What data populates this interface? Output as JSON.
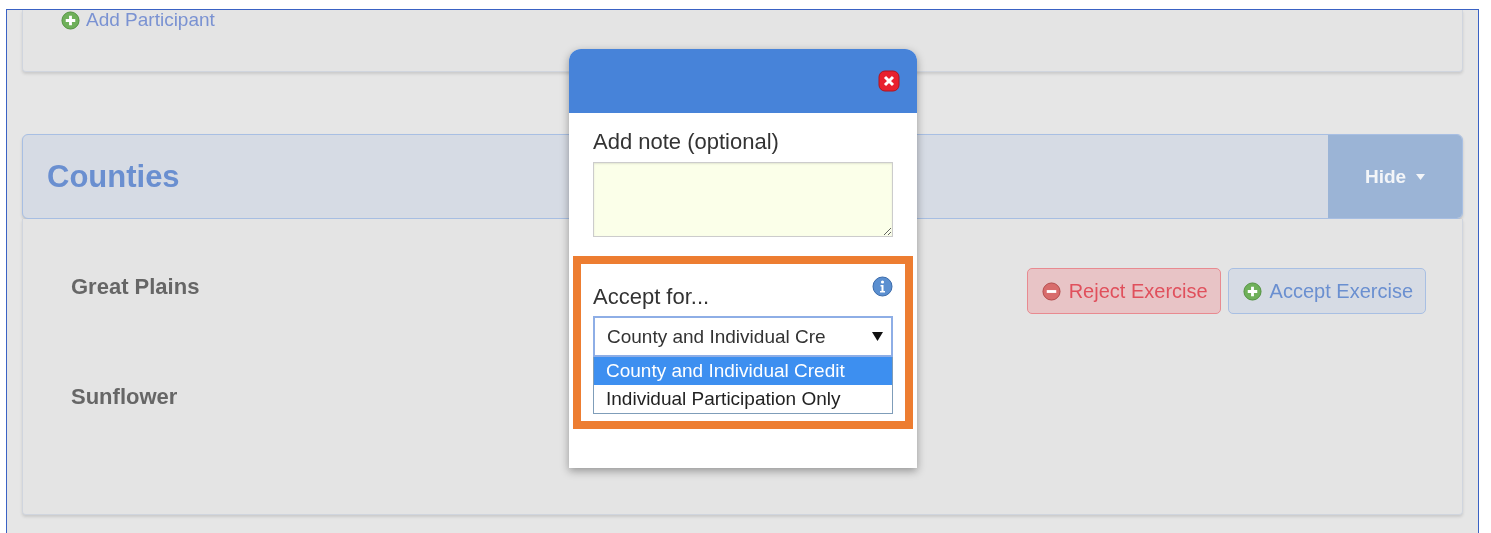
{
  "top_card": {
    "add_link": "Add Participant"
  },
  "panel": {
    "title": "Counties",
    "hide_button": "Hide",
    "rows": [
      {
        "name": "Great Plains",
        "buttons": [
          {
            "kind": "reject",
            "label": "Reject Exercise"
          },
          {
            "kind": "accept",
            "label": "Accept Exercise"
          }
        ]
      },
      {
        "name": "Sunflower",
        "buttons": []
      }
    ]
  },
  "modal": {
    "note_label": "Add note (optional)",
    "accept_label": "Accept for...",
    "select_value": "County and Individual Cre",
    "options": [
      {
        "label": "County and Individual Credit",
        "selected": true
      },
      {
        "label": "Individual Participation Only",
        "selected": false
      }
    ]
  }
}
